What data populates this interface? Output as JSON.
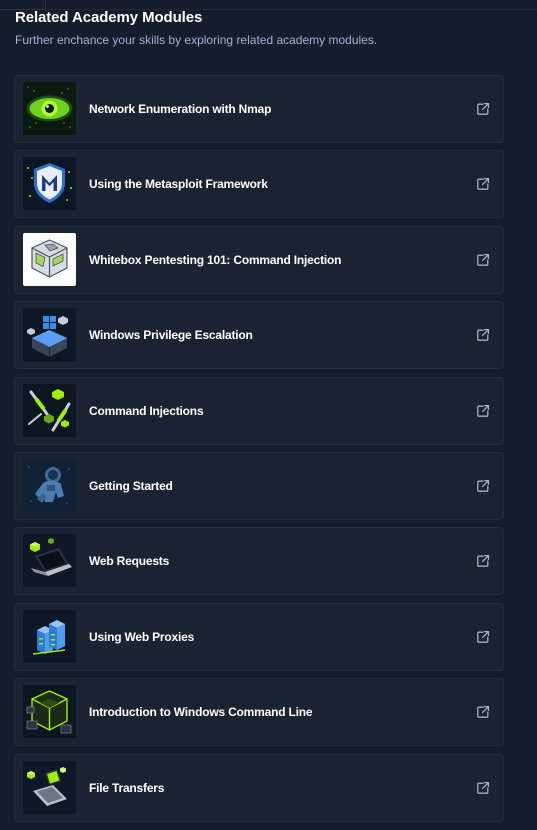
{
  "header": {
    "title": "Related Academy Modules",
    "subtitle": "Further enchance your skills by exploring related academy modules."
  },
  "modules": [
    {
      "label": "Network Enumeration with Nmap",
      "icon": "nmap-eye-icon"
    },
    {
      "label": "Using the Metasploit Framework",
      "icon": "metasploit-shield-icon"
    },
    {
      "label": "Whitebox Pentesting 101: Command Injection",
      "icon": "whitebox-cube-icon"
    },
    {
      "label": "Windows Privilege Escalation",
      "icon": "windows-server-icon"
    },
    {
      "label": "Command Injections",
      "icon": "command-injection-syringe-icon"
    },
    {
      "label": "Getting Started",
      "icon": "astronaut-icon"
    },
    {
      "label": "Web Requests",
      "icon": "laptop-cubes-icon"
    },
    {
      "label": "Using Web Proxies",
      "icon": "proxy-servers-icon"
    },
    {
      "label": "Introduction to Windows Command Line",
      "icon": "command-line-cube-icon"
    },
    {
      "label": "File Transfers",
      "icon": "file-transfer-laptop-icon"
    }
  ],
  "colors": {
    "background": "#141d2b",
    "card": "#1a2332",
    "accent": "#9fef00",
    "subtitle": "#a4b1cd"
  },
  "external_link_icon": "external-link-icon"
}
